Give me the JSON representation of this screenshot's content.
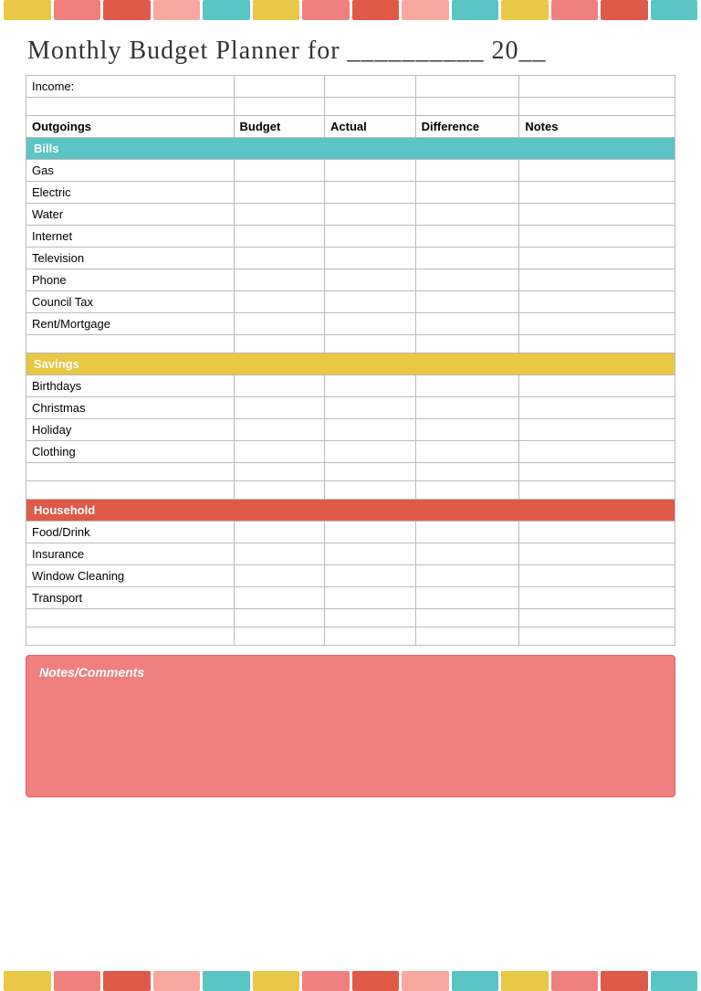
{
  "topBar": {
    "segments": [
      {
        "color": "#e8c844"
      },
      {
        "color": "#f08080"
      },
      {
        "color": "#e05a4a"
      },
      {
        "color": "#f9a8a0"
      },
      {
        "color": "#5bc4c4"
      },
      {
        "color": "#e8c844"
      },
      {
        "color": "#f08080"
      },
      {
        "color": "#e05a4a"
      },
      {
        "color": "#f9a8a0"
      },
      {
        "color": "#5bc4c4"
      },
      {
        "color": "#e8c844"
      },
      {
        "color": "#f08080"
      },
      {
        "color": "#e05a4a"
      },
      {
        "color": "#5bc4c4"
      }
    ]
  },
  "title": "Monthly Budget Planner for __________ 20__",
  "columns": {
    "label": "Outgoings",
    "budget": "Budget",
    "actual": "Actual",
    "difference": "Difference",
    "notes": "Notes"
  },
  "income": {
    "label": "Income:"
  },
  "sections": {
    "bills": {
      "header": "Bills",
      "items": [
        "Gas",
        "Electric",
        "Water",
        "Internet",
        "Television",
        "Phone",
        "Council Tax",
        "Rent/Mortgage"
      ]
    },
    "savings": {
      "header": "Savings",
      "items": [
        "Birthdays",
        "Christmas",
        "Holiday",
        "Clothing"
      ]
    },
    "household": {
      "header": "Household",
      "items": [
        "Food/Drink",
        "Insurance",
        "Window Cleaning",
        "Transport"
      ]
    }
  },
  "notes": {
    "title": "Notes/Comments"
  },
  "bottomBar": {
    "segments": [
      {
        "color": "#e8c844"
      },
      {
        "color": "#f08080"
      },
      {
        "color": "#e05a4a"
      },
      {
        "color": "#f9a8a0"
      },
      {
        "color": "#5bc4c4"
      },
      {
        "color": "#e8c844"
      },
      {
        "color": "#f08080"
      },
      {
        "color": "#e05a4a"
      },
      {
        "color": "#f9a8a0"
      },
      {
        "color": "#5bc4c4"
      },
      {
        "color": "#e8c844"
      },
      {
        "color": "#f08080"
      },
      {
        "color": "#e05a4a"
      },
      {
        "color": "#5bc4c4"
      }
    ]
  }
}
